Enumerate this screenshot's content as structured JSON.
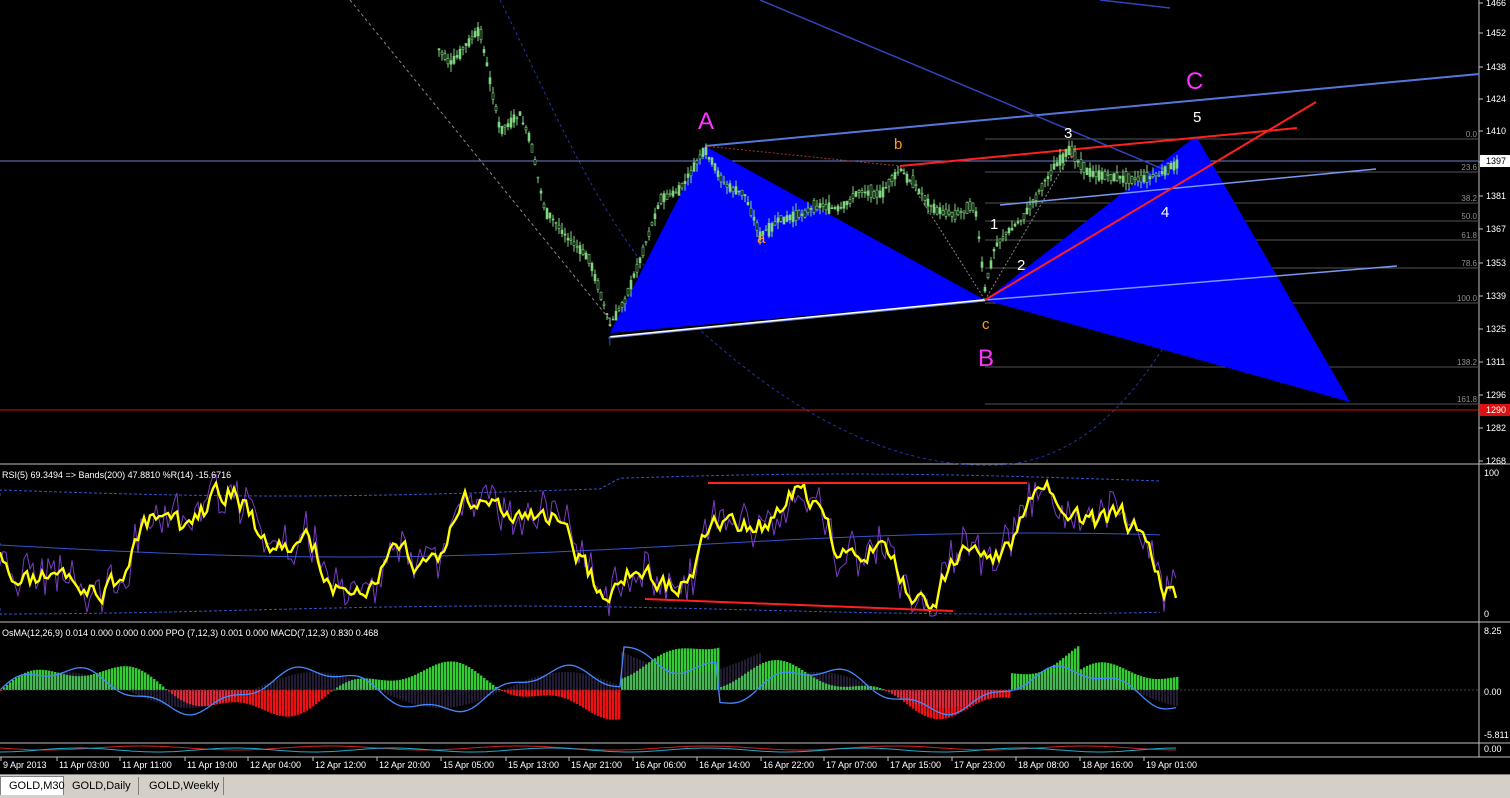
{
  "window": {
    "title_fragment": "GOLD,M30"
  },
  "colors": {
    "background": "#000000",
    "bull_candle": "#7fd67f",
    "bear_candle": "#7fd67f",
    "pattern_fill": "#0000ff",
    "channel_line": "#4466ff",
    "red_line": "#ff2020",
    "rsi_line": "#ffff00",
    "percentr_line": "#7a3cc8",
    "bands_line": "#3355cc",
    "osma_pos": "#33cc33",
    "osma_neg": "#ee1111",
    "macd_line": "#4488ff",
    "fib_text": "#909090",
    "wave_magenta": "#ff33ff",
    "wave_orange": "#ff9922",
    "wave_white": "#ffffff"
  },
  "main_chart": {
    "price_axis_labels": [
      "1466",
      "1452",
      "1438",
      "1424",
      "1410",
      "1397",
      "1381",
      "1367",
      "1353",
      "1339",
      "1325",
      "1311",
      "1296",
      "1282",
      "1268"
    ],
    "current_price_tag": "1397",
    "red_level_tag": "1290",
    "fib_labels": [
      "0.0",
      "23.6",
      "38.2",
      "50.0",
      "61.8",
      "78.6",
      "100.0",
      "138.2",
      "161.8"
    ],
    "wave_labels": {
      "A": "A",
      "B": "B",
      "C": "C",
      "a": "a",
      "b": "b",
      "c": "c",
      "w1": "1",
      "w2": "2",
      "w3": "3",
      "w4": "4",
      "w5": "5"
    }
  },
  "rsi_panel": {
    "header": "RSI(5) 69.3494  => Bands(200) 47.8810  %R(14) -15.6716",
    "axis_top": "100",
    "axis_bottom": "0"
  },
  "macd_panel": {
    "header": "OsMA(12,26,9) 0.014 0.000 0.000 0.000   PPO (7,12,3) 0.001 0.000   MACD(7,12,3) 0.830 0.468",
    "axis_labels": [
      "8.25",
      "0.00",
      "-5.811"
    ],
    "axis_lower_tag": "0.00"
  },
  "time_axis": {
    "labels": [
      "9 Apr 2013",
      "11 Apr 03:00",
      "11 Apr 11:00",
      "11 Apr 19:00",
      "12 Apr 04:00",
      "12 Apr 12:00",
      "12 Apr 20:00",
      "15 Apr 05:00",
      "15 Apr 13:00",
      "15 Apr 21:00",
      "16 Apr 06:00",
      "16 Apr 14:00",
      "16 Apr 22:00",
      "17 Apr 07:00",
      "17 Apr 15:00",
      "17 Apr 23:00",
      "18 Apr 08:00",
      "18 Apr 16:00",
      "19 Apr 01:00"
    ]
  },
  "tabs": [
    {
      "label": "GOLD,M30",
      "active": true
    },
    {
      "label": "GOLD,Daily",
      "active": false
    },
    {
      "label": "GOLD,Weekly",
      "active": false
    }
  ]
}
